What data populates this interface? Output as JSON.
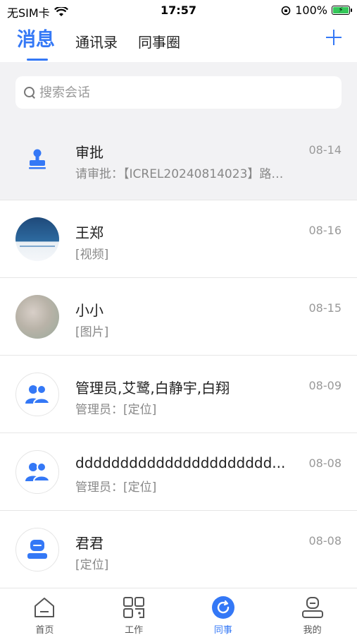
{
  "status_bar": {
    "carrier": "无SIM卡",
    "time": "17:57",
    "battery": "100%"
  },
  "header": {
    "tabs": [
      {
        "label": "消息",
        "active": true
      },
      {
        "label": "通讯录",
        "active": false
      },
      {
        "label": "同事圈",
        "active": false
      }
    ],
    "add_icon": "plus-icon"
  },
  "search": {
    "placeholder": "搜索会话"
  },
  "conversations": [
    {
      "name": "审批",
      "preview": "请审批：【ICREL20240814023】路…",
      "date": "08-14",
      "avatar": "approval-icon"
    },
    {
      "name": "王郑",
      "preview": "[视频]",
      "date": "08-16",
      "avatar": "photo"
    },
    {
      "name": "小小",
      "preview": "[图片]",
      "date": "08-15",
      "avatar": "photo"
    },
    {
      "name": "管理员,艾鹭,白静宇,白翔",
      "preview": "管理员：[定位]",
      "date": "08-09",
      "avatar": "group-icon"
    },
    {
      "name": "dddddddddddddddddddddd...",
      "preview": "管理员：[定位]",
      "date": "08-08",
      "avatar": "group-icon"
    },
    {
      "name": "君君",
      "preview": "[定位]",
      "date": "08-08",
      "avatar": "user-icon"
    }
  ],
  "tabbar": {
    "items": [
      {
        "label": "首页",
        "icon": "home-icon",
        "active": false
      },
      {
        "label": "工作",
        "icon": "grid-icon",
        "active": false
      },
      {
        "label": "同事",
        "icon": "colleague-icon",
        "active": true
      },
      {
        "label": "我的",
        "icon": "profile-icon",
        "active": false
      }
    ]
  },
  "colors": {
    "accent": "#3478f6",
    "text": "#222222",
    "muted": "#999999",
    "background_gray": "#f2f2f4"
  }
}
